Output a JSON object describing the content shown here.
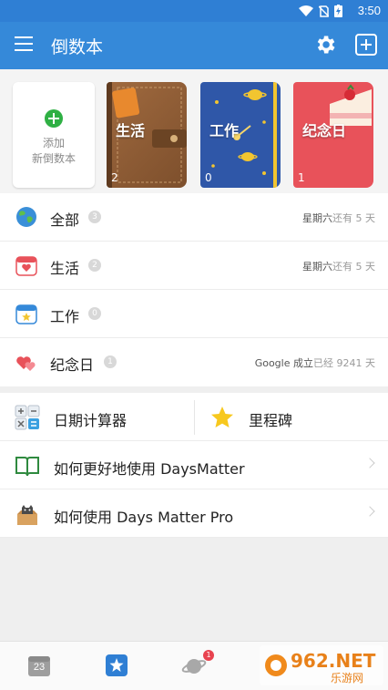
{
  "status_bar": {
    "time": "3:50"
  },
  "app_bar": {
    "title": "倒数本"
  },
  "books": {
    "add_card": {
      "line1": "添加",
      "line2": "新倒数本"
    },
    "items": [
      {
        "name": "生活",
        "count": "2"
      },
      {
        "name": "工作",
        "count": "0"
      },
      {
        "name": "纪念日",
        "count": "1"
      }
    ]
  },
  "categories": [
    {
      "label": "全部",
      "badge": "3",
      "right_main": "星期六",
      "right_muted": "还有 5 天"
    },
    {
      "label": "生活",
      "badge": "2",
      "right_main": "星期六",
      "right_muted": "还有 5 天"
    },
    {
      "label": "工作",
      "badge": "0",
      "right_main": "",
      "right_muted": ""
    },
    {
      "label": "纪念日",
      "badge": "1",
      "right_main": "Google 成立",
      "right_muted": "已经 9241 天"
    }
  ],
  "tools": {
    "date_calculator": "日期计算器",
    "milestone": "里程碑",
    "howto_daysmatter": "如何更好地使用 DaysMatter",
    "howto_pro": "如何使用 Days Matter Pro"
  },
  "bottom_nav": {
    "calendar_day": "23",
    "planet_badge": "1"
  },
  "watermark": {
    "brand": "962.NET",
    "sub": "乐游网"
  },
  "colors": {
    "app_bar": "#3589d9",
    "status_bar": "#2f7fd4",
    "add_green": "#2fb044",
    "anniversary_red": "#e8525a",
    "work_blue": "#2f57a8",
    "life_brown": "#8a5a33"
  },
  "icons": [
    "menu-icon",
    "gear-icon",
    "add-book-icon",
    "globe-icon",
    "calendar-heart-icon",
    "calendar-star-icon",
    "hearts-icon",
    "calculator-icon",
    "star-icon",
    "book-icon",
    "cat-box-icon",
    "calendar-nav-icon",
    "star-nav-icon",
    "planet-nav-icon"
  ]
}
